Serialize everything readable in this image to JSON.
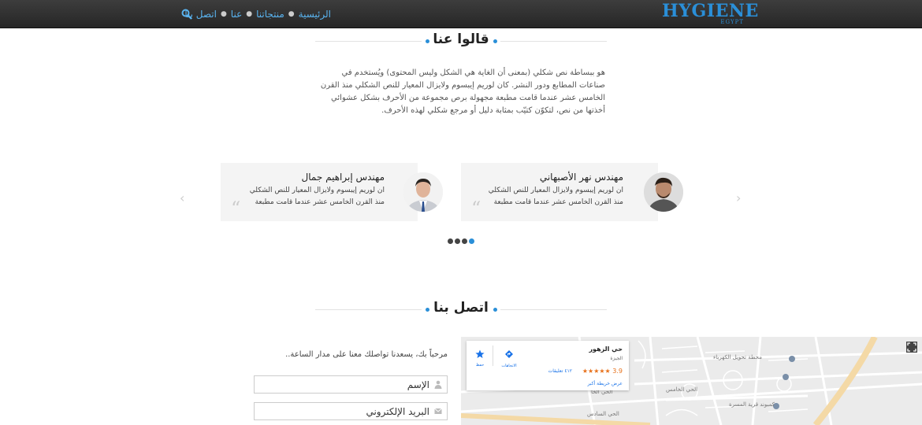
{
  "brand": {
    "name": "HYGIENE",
    "sub": "EGYPT",
    "color": "#2a8fd8"
  },
  "nav": {
    "items": [
      {
        "label": "الرئيسية"
      },
      {
        "label": "منتجاتنا"
      },
      {
        "label": "عنا"
      },
      {
        "label": "اتصل بنا"
      }
    ],
    "search_icon": "search-icon"
  },
  "testimonials_section": {
    "title": "قالوا عنا",
    "intro": "هو ببساطة نص شكلي (بمعنى أن الغاية هي الشكل وليس المحتوى) ويُستخدم في صناعات المطابع ودور النشر. كان لوريم إيبسوم ولايزال المعيار للنص الشكلي منذ القرن الخامس عشر عندما قامت مطبعة مجهولة برص مجموعة من الأحرف بشكل عشوائي أخذتها من نص، لتكوّن كتيّب بمثابة دليل أو مرجع شكلي لهذه الأحرف.",
    "cards": [
      {
        "name": "مهندس نهر الأصبهاني",
        "text": "ان لوريم إيبسوم ولايزال المعيار للنص الشكلي منذ القرن الخامس عشر عندما قامت مطبعة"
      },
      {
        "name": "مهندس إبراهيم جمال",
        "text": "ان لوريم إيبسوم ولايزال المعيار للنص الشكلي منذ القرن الخامس عشر عندما قامت مطبعة"
      }
    ],
    "prev_arrow": "‹",
    "next_arrow": "›",
    "quote_mark": "“"
  },
  "contact_section": {
    "title": "اتصل بنا",
    "message": "مرحباً بك، يسعدنا تواصلك معنا على مدار الساعة..",
    "name_field": "الإسم",
    "email_field": "البريد الإلكتروني"
  },
  "map": {
    "place_name": "حي الزهور",
    "region": "الجيزة",
    "rating": "3.9 ★★★★★",
    "reviews": "٤١٢ تعليقات",
    "larger_map": "عرض خريطة أكبر",
    "directions": "الاتجاهات",
    "save": "حفظ",
    "labels": {
      "l1": "محطة تحويل الكهرباء",
      "l2": "الحي الخامس",
      "l3": "الحي السادس",
      "l4": "كمبوند قرية المسرة",
      "l5": "الحي الخا"
    }
  }
}
